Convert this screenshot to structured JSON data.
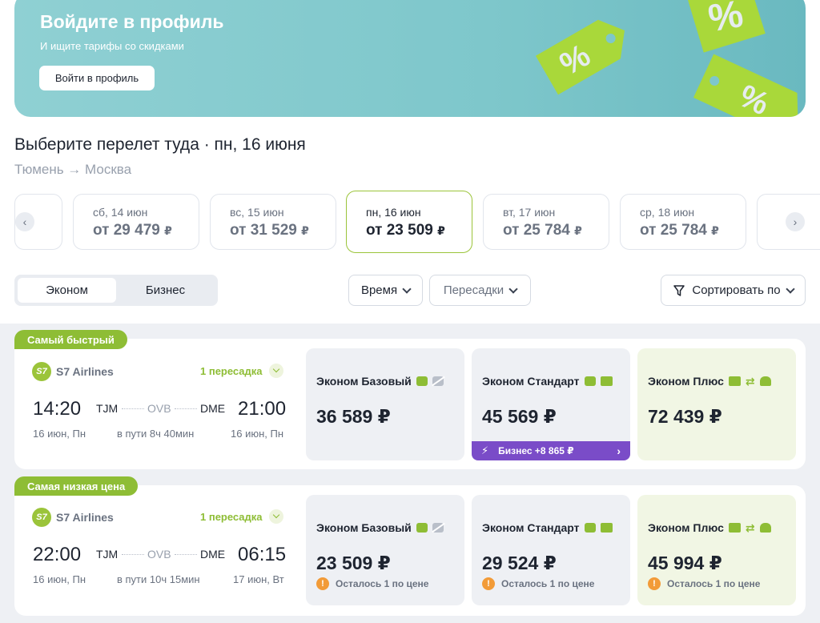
{
  "banner": {
    "title": "Войдите в профиль",
    "subtitle": "И ищите тарифы со скидками",
    "button": "Войти в профиль",
    "tag_symbol": "%"
  },
  "heading": "Выберите перелет туда · пн, 16 июня",
  "route": "Тюмень → Москва",
  "dates": [
    {
      "label": "сб, 14 июн",
      "price": "от 29 479",
      "currency": "₽"
    },
    {
      "label": "вс, 15 июн",
      "price": "от 31 529",
      "currency": "₽"
    },
    {
      "label": "пн, 16 июн",
      "price": "от 23 509",
      "currency": "₽",
      "active": true
    },
    {
      "label": "вт, 17 июн",
      "price": "от 25 784",
      "currency": "₽"
    },
    {
      "label": "ср, 18 июн",
      "price": "от 25 784",
      "currency": "₽"
    }
  ],
  "nav": {
    "prev": "‹",
    "next": "›"
  },
  "class_toggle": {
    "economy": "Эконом",
    "business": "Бизнес",
    "selected": "Эконом"
  },
  "filters": {
    "time": "Время",
    "transfers": "Пересадки",
    "sort": "Сортировать по"
  },
  "flights": [
    {
      "badge": "Самый быстрый",
      "airline": "S7 Airlines",
      "logo_text": "S7",
      "stops": "1 пересадка",
      "dep_time": "14:20",
      "arr_time": "21:00",
      "from": "TJM",
      "via": "OVB",
      "to": "DME",
      "dep_date": "16 июн, Пн",
      "duration": "в пути 8ч 40мин",
      "arr_date": "16 июн, Пн",
      "fares": [
        {
          "name": "Эконом Базовый",
          "price": "36 589 ₽"
        },
        {
          "name": "Эконом Стандарт",
          "price": "45 569 ₽",
          "upsell": "Бизнес +8 865 ₽"
        },
        {
          "name": "Эконом Плюс",
          "price": "72 439 ₽"
        }
      ]
    },
    {
      "badge": "Самая низкая цена",
      "airline": "S7 Airlines",
      "logo_text": "S7",
      "stops": "1 пересадка",
      "dep_time": "22:00",
      "arr_time": "06:15",
      "from": "TJM",
      "via": "OVB",
      "to": "DME",
      "dep_date": "16 июн, Пн",
      "duration": "в пути 10ч 15мин",
      "arr_date": "17 июн, Вт",
      "fares": [
        {
          "name": "Эконом Базовый",
          "price": "23 509 ₽",
          "note": "Осталось 1 по цене"
        },
        {
          "name": "Эконом Стандарт",
          "price": "29 524 ₽",
          "note": "Осталось 1 по цене"
        },
        {
          "name": "Эконом Плюс",
          "price": "45 994 ₽",
          "note": "Осталось 1 по цене"
        }
      ]
    }
  ],
  "colors": {
    "accent": "#9bc43a",
    "upsell": "#7a4cc8",
    "banner": "#7ec7cb",
    "warning": "#f29b38"
  }
}
